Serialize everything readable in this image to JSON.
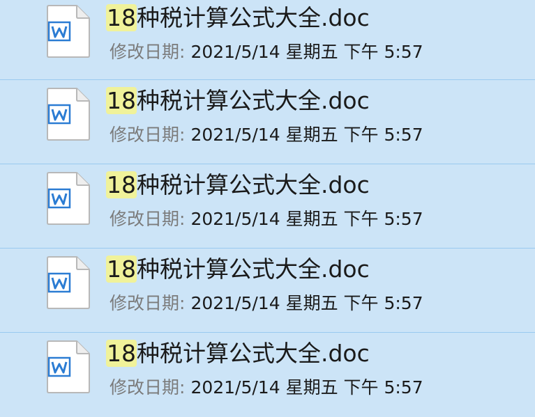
{
  "files": [
    {
      "name_highlight": "18",
      "name_rest": "种税计算公式大全.doc",
      "meta_label": "修改日期:",
      "meta_value": "2021/5/14 星期五 下午 5:57",
      "icon": "word-document-icon"
    },
    {
      "name_highlight": "18",
      "name_rest": "种税计算公式大全.doc",
      "meta_label": "修改日期:",
      "meta_value": "2021/5/14 星期五 下午 5:57",
      "icon": "word-document-icon"
    },
    {
      "name_highlight": "18",
      "name_rest": "种税计算公式大全.doc",
      "meta_label": "修改日期:",
      "meta_value": "2021/5/14 星期五 下午 5:57",
      "icon": "word-document-icon"
    },
    {
      "name_highlight": "18",
      "name_rest": "种税计算公式大全.doc",
      "meta_label": "修改日期:",
      "meta_value": "2021/5/14 星期五 下午 5:57",
      "icon": "word-document-icon"
    },
    {
      "name_highlight": "18",
      "name_rest": "种税计算公式大全.doc",
      "meta_label": "修改日期:",
      "meta_value": "2021/5/14 星期五 下午 5:57",
      "icon": "word-document-icon"
    }
  ],
  "colors": {
    "selection_bg": "#cce4f7",
    "row_divider": "#99c9ef",
    "search_highlight": "#f0f29a",
    "word_blue": "#2b7cd3"
  }
}
